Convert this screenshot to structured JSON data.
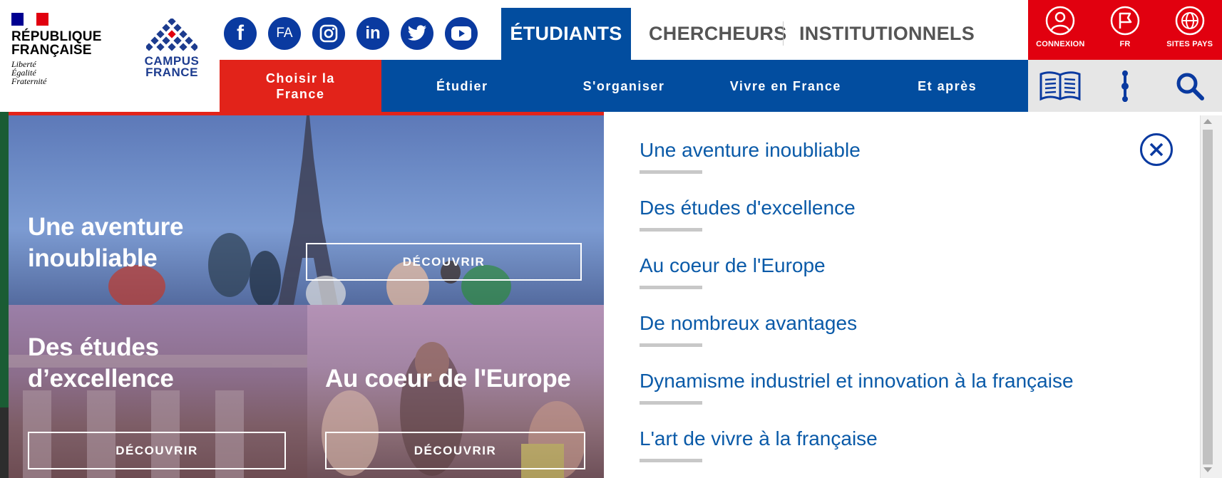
{
  "header": {
    "republique": {
      "name_line1": "RÉPUBLIQUE",
      "name_line2": "FRANÇAISE",
      "motto1": "Liberté",
      "motto2": "Égalité",
      "motto3": "Fraternité",
      "flag_colors": [
        "#000091",
        "#ffffff",
        "#e1000f"
      ]
    },
    "campus_logo": {
      "line1": "CAMPUS",
      "line2": "FRANCE",
      "color": "#1d3c8f"
    },
    "social": [
      {
        "name": "facebook-icon",
        "text": "f"
      },
      {
        "name": "fa-icon",
        "text": "FA"
      },
      {
        "name": "instagram-icon",
        "text": ""
      },
      {
        "name": "linkedin-icon",
        "text": "in"
      },
      {
        "name": "twitter-icon",
        "text": ""
      },
      {
        "name": "youtube-icon",
        "text": ""
      }
    ],
    "audience_tabs": [
      "ÉTUDIANTS",
      "CHERCHEURS",
      "INSTITUTIONNELS"
    ],
    "red_actions": [
      "CONNEXION",
      "FR",
      "SITES PAYS"
    ],
    "nav": [
      "Choisir la France",
      "Étudier",
      "S'organiser",
      "Vivre en France",
      "Et après"
    ],
    "tools": [
      "book-icon",
      "menu-dots-icon",
      "search-icon"
    ],
    "colors": {
      "primary_blue": "#024d9f",
      "red": "#e1000f",
      "link_blue": "#0a5aa8"
    }
  },
  "tiles": [
    {
      "title": "Une aventure inoubliable",
      "button": "DÉCOUVRIR"
    },
    {
      "title": "Des études d’excellence",
      "button": "DÉCOUVRIR"
    },
    {
      "title": "Au coeur de l'Europe",
      "button": "DÉCOUVRIR"
    }
  ],
  "panel": {
    "items": [
      "Une aventure inoubliable",
      "Des études d'excellence",
      "Au coeur de l'Europe",
      "De nombreux avantages",
      "Dynamisme industriel et innovation à la française",
      "L'art de vivre à la française"
    ]
  }
}
